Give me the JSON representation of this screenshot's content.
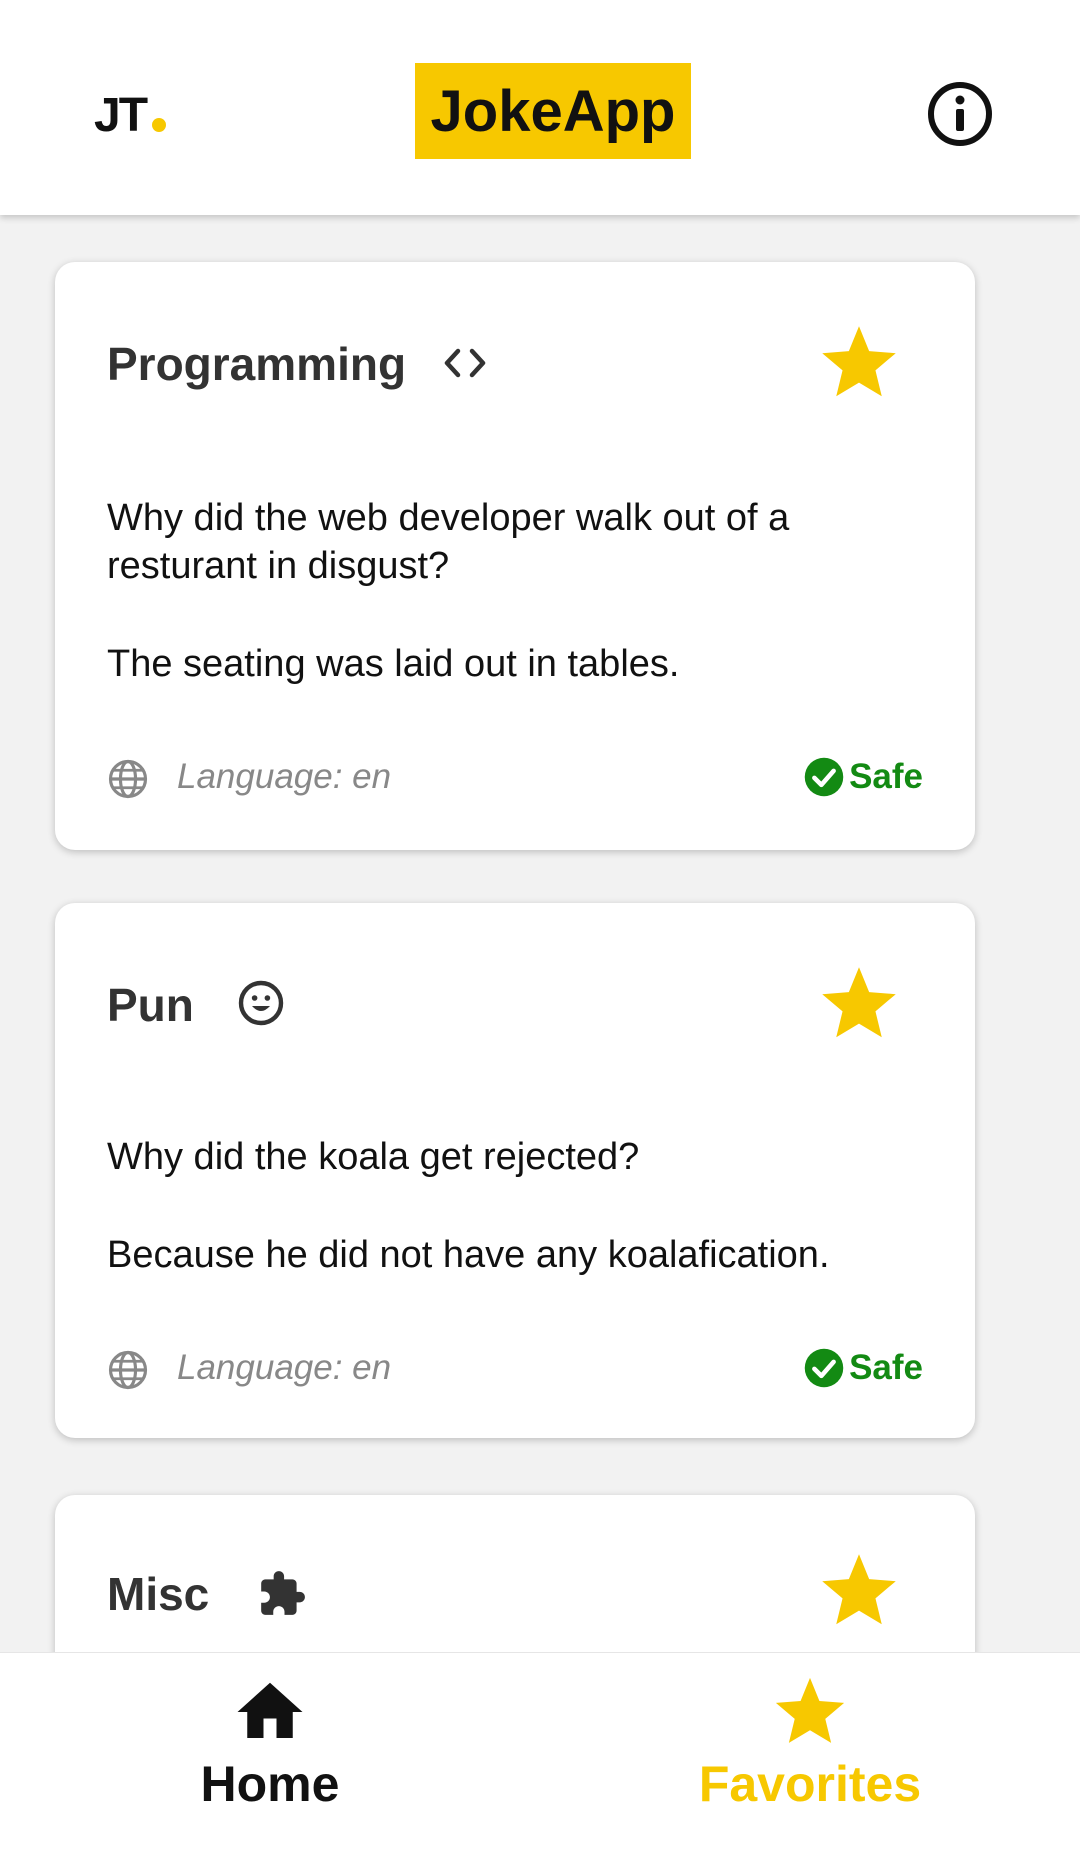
{
  "header": {
    "logo": "JT",
    "title": "JokeApp",
    "info_icon": "info-icon",
    "accent_color": "#f7c800"
  },
  "jokes": [
    {
      "category": "Programming",
      "category_icon": "code-icon",
      "setup": "Why did the web developer walk out of a resturant in disgust?",
      "delivery": "The seating was laid out in tables.",
      "language": "Language: en",
      "safe_label": "Safe",
      "favorited": true
    },
    {
      "category": "Pun",
      "category_icon": "smiley-icon",
      "setup": "Why did the koala get rejected?",
      "delivery": "Because he did not have any koalafication.",
      "language": "Language: en",
      "safe_label": "Safe",
      "favorited": true
    },
    {
      "category": "Misc",
      "category_icon": "puzzle-icon",
      "favorited": true
    }
  ],
  "bottom_nav": {
    "home_label": "Home",
    "favorites_label": "Favorites"
  },
  "colors": {
    "safe": "#138a13",
    "star": "#f7c800"
  }
}
